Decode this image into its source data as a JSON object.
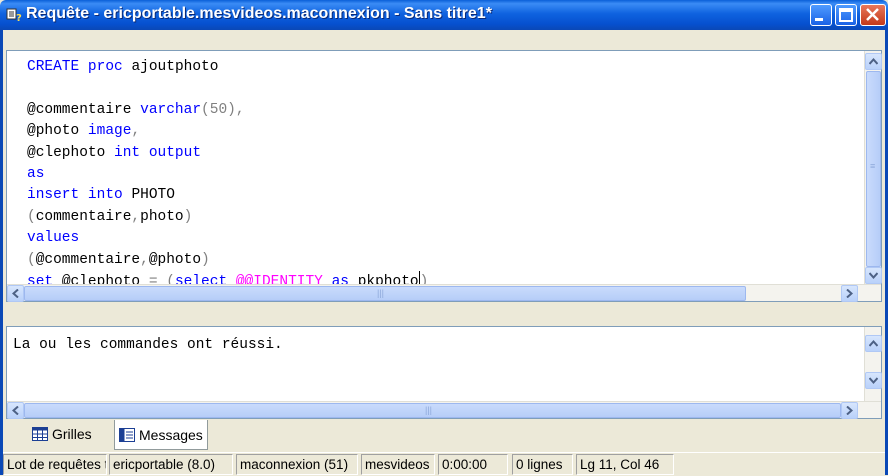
{
  "window": {
    "title": "Requête - ericportable.mesvideos.maconnexion - Sans titre1*"
  },
  "editor": {
    "lines": [
      [
        {
          "t": "CREATE ",
          "c": "kw"
        },
        {
          "t": "proc ",
          "c": "kw"
        },
        {
          "t": "ajoutphoto",
          "c": ""
        }
      ],
      [],
      [
        {
          "t": "@commentaire ",
          "c": ""
        },
        {
          "t": "varchar",
          "c": "kw"
        },
        {
          "t": "(50),",
          "c": "gr"
        }
      ],
      [
        {
          "t": "@photo ",
          "c": ""
        },
        {
          "t": "image",
          "c": "kw"
        },
        {
          "t": ",",
          "c": "gr"
        }
      ],
      [
        {
          "t": "@clephoto ",
          "c": ""
        },
        {
          "t": "int ",
          "c": "kw"
        },
        {
          "t": "output",
          "c": "kw"
        }
      ],
      [
        {
          "t": "as",
          "c": "kw"
        }
      ],
      [
        {
          "t": "insert ",
          "c": "kw"
        },
        {
          "t": "into ",
          "c": "kw"
        },
        {
          "t": "PHOTO",
          "c": ""
        }
      ],
      [
        {
          "t": "(",
          "c": "gr"
        },
        {
          "t": "commentaire",
          "c": ""
        },
        {
          "t": ",",
          "c": "gr"
        },
        {
          "t": "photo",
          "c": ""
        },
        {
          "t": ")",
          "c": "gr"
        }
      ],
      [
        {
          "t": "values",
          "c": "kw"
        }
      ],
      [
        {
          "t": "(",
          "c": "gr"
        },
        {
          "t": "@commentaire",
          "c": ""
        },
        {
          "t": ",",
          "c": "gr"
        },
        {
          "t": "@photo",
          "c": ""
        },
        {
          "t": ")",
          "c": "gr"
        }
      ],
      [
        {
          "t": "set ",
          "c": "kw"
        },
        {
          "t": "@clephoto ",
          "c": ""
        },
        {
          "t": "= (",
          "c": "gr"
        },
        {
          "t": "select ",
          "c": "kw"
        },
        {
          "t": "@@IDENTITY ",
          "c": "fn"
        },
        {
          "t": "as ",
          "c": "kw"
        },
        {
          "t": "pkphoto",
          "c": ""
        },
        {
          "t": ")",
          "c": "gr"
        }
      ]
    ]
  },
  "results": {
    "message": "La ou les commandes ont réussi."
  },
  "tabs": [
    {
      "label": "Grilles"
    },
    {
      "label": "Messages"
    }
  ],
  "status": {
    "batch": "Lot de requêtes t",
    "server": "ericportable (8.0)",
    "user": "maconnexion (51)",
    "database": "mesvideos",
    "elapsed": "0:00:00",
    "rows": "0 lignes",
    "position": "Lg 11, Col 46"
  },
  "colors": {
    "keyword": "#0000ff",
    "operator": "#808080",
    "function": "#ff00ff",
    "titlebar": "#0a5fd8"
  }
}
